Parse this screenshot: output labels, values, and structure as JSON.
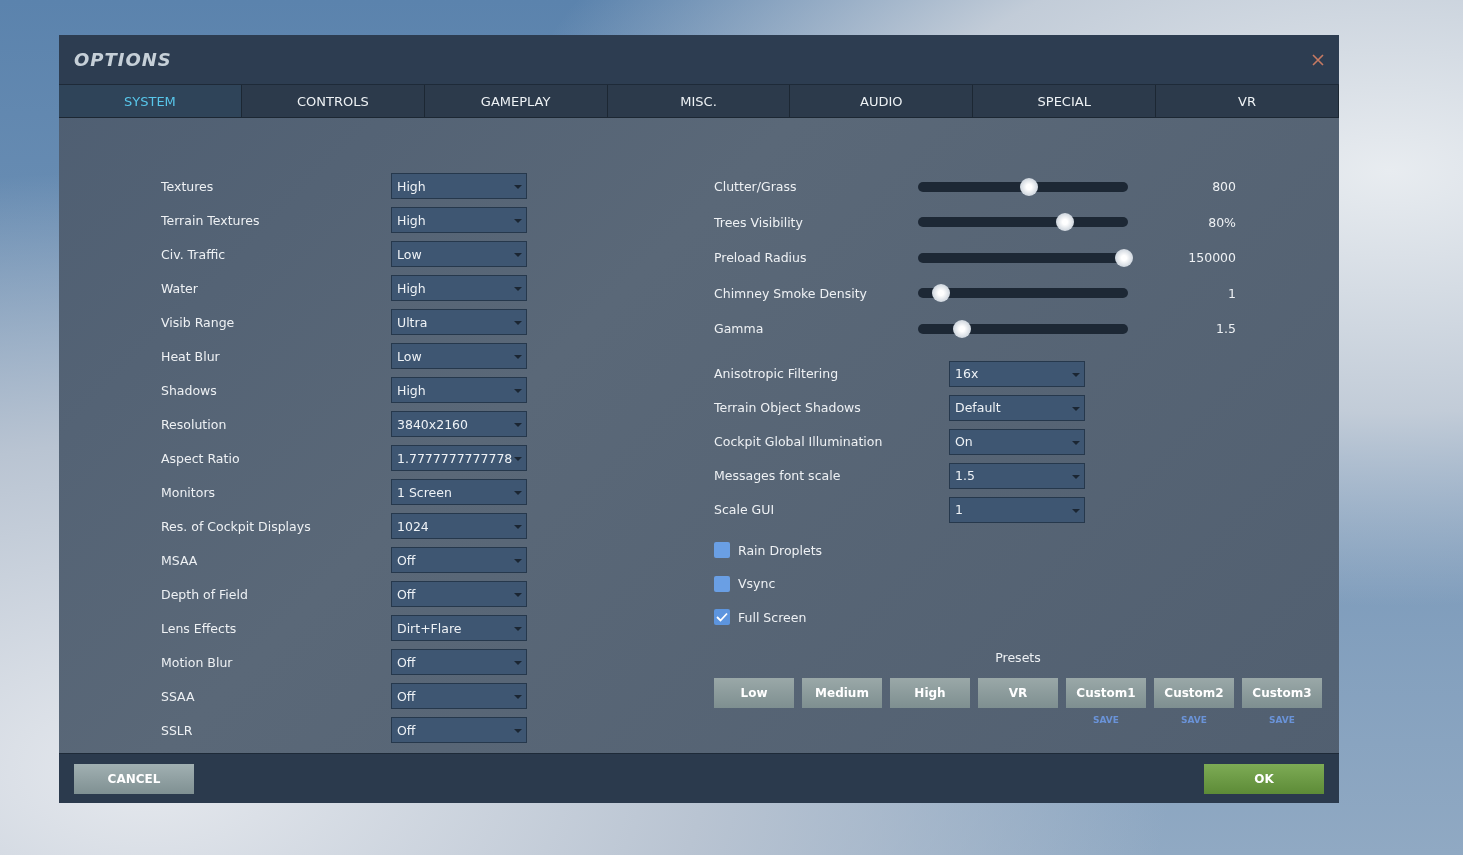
{
  "window": {
    "title": "OPTIONS"
  },
  "tabs": [
    {
      "label": "SYSTEM",
      "selected": true
    },
    {
      "label": "CONTROLS",
      "selected": false
    },
    {
      "label": "GAMEPLAY",
      "selected": false
    },
    {
      "label": "MISC.",
      "selected": false
    },
    {
      "label": "AUDIO",
      "selected": false
    },
    {
      "label": "SPECIAL",
      "selected": false
    },
    {
      "label": "VR",
      "selected": false
    }
  ],
  "left_settings": [
    {
      "label": "Textures",
      "value": "High"
    },
    {
      "label": "Terrain Textures",
      "value": "High"
    },
    {
      "label": "Civ. Traffic",
      "value": "Low"
    },
    {
      "label": "Water",
      "value": "High"
    },
    {
      "label": "Visib Range",
      "value": "Ultra"
    },
    {
      "label": "Heat Blur",
      "value": "Low"
    },
    {
      "label": "Shadows",
      "value": "High"
    },
    {
      "label": "Resolution",
      "value": "3840x2160"
    },
    {
      "label": "Aspect Ratio",
      "value": "1.7777777777778"
    },
    {
      "label": "Monitors",
      "value": "1 Screen"
    },
    {
      "label": "Res. of Cockpit Displays",
      "value": "1024"
    },
    {
      "label": "MSAA",
      "value": "Off"
    },
    {
      "label": "Depth of Field",
      "value": "Off"
    },
    {
      "label": "Lens Effects",
      "value": "Dirt+Flare"
    },
    {
      "label": "Motion Blur",
      "value": "Off"
    },
    {
      "label": "SSAA",
      "value": "Off"
    },
    {
      "label": "SSLR",
      "value": "Off"
    }
  ],
  "sliders": [
    {
      "label": "Clutter/Grass",
      "level": 0.53,
      "reading": "800"
    },
    {
      "label": "Trees Visibility",
      "level": 0.7,
      "reading": "80%"
    },
    {
      "label": "Preload Radius",
      "level": 0.98,
      "reading": "150000"
    },
    {
      "label": "Chimney Smoke Density",
      "level": 0.11,
      "reading": "1"
    },
    {
      "label": "Gamma",
      "level": 0.21,
      "reading": "1.5"
    }
  ],
  "right_settings": [
    {
      "label": "Anisotropic Filtering",
      "value": "16x"
    },
    {
      "label": "Terrain Object Shadows",
      "value": "Default"
    },
    {
      "label": "Cockpit Global Illumination",
      "value": "On"
    },
    {
      "label": "Messages font scale",
      "value": "1.5"
    },
    {
      "label": "Scale GUI",
      "value": "1"
    }
  ],
  "checkboxes": [
    {
      "label": "Rain Droplets",
      "checked": false
    },
    {
      "label": "Vsync",
      "checked": false
    },
    {
      "label": "Full Screen",
      "checked": true
    }
  ],
  "presets": {
    "title": "Presets",
    "buttons": [
      {
        "label": "Low"
      },
      {
        "label": "Medium"
      },
      {
        "label": "High"
      },
      {
        "label": "VR"
      },
      {
        "label": "Custom1",
        "save": "SAVE"
      },
      {
        "label": "Custom2",
        "save": "SAVE"
      },
      {
        "label": "Custom3",
        "save": "SAVE"
      }
    ]
  },
  "footer": {
    "cancel": "CANCEL",
    "ok": "OK"
  }
}
